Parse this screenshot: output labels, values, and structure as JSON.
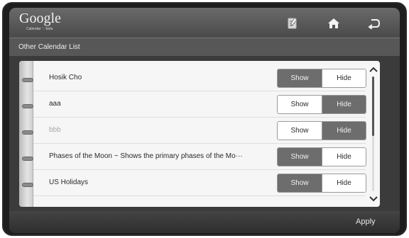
{
  "header": {
    "logo_text": "Google",
    "logo_sub": "Calendar ♡ beta",
    "icons": [
      "notes-icon",
      "home-icon",
      "back-icon"
    ]
  },
  "subheader": {
    "title": "Other Calendar List"
  },
  "calendars": [
    {
      "name": "Hosik Cho",
      "selected": "Show",
      "dimmed": false
    },
    {
      "name": "aaa",
      "selected": "Hide",
      "dimmed": false
    },
    {
      "name": "bbb",
      "selected": "Hide",
      "dimmed": true
    },
    {
      "name": "Phases of the Moon ~ Shows the primary phases of the Mo···",
      "selected": "Show",
      "dimmed": false
    },
    {
      "name": "US Holidays",
      "selected": "Show",
      "dimmed": false
    }
  ],
  "toggle": {
    "show_label": "Show",
    "hide_label": "Hide"
  },
  "footer": {
    "apply_label": "Apply"
  },
  "colors": {
    "active_segment": "#6d6d6d",
    "inactive_segment": "#ffffff",
    "frame": "#3b3b3b"
  }
}
